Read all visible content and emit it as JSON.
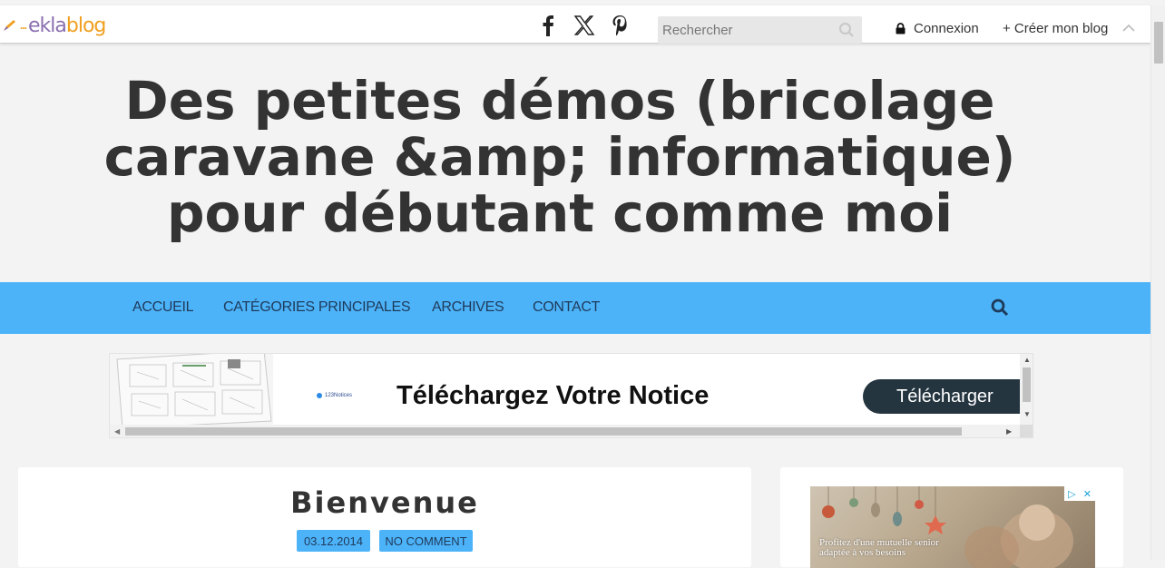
{
  "topbar": {
    "logo_ekla": "ekla",
    "logo_blog": "blog",
    "search_placeholder": "Rechercher",
    "login_label": "Connexion",
    "create_label": "+ Créer mon blog"
  },
  "site": {
    "title": "Des petites démos (bricolage caravane &amp; informatique) pour débutant comme moi"
  },
  "nav": {
    "items": [
      {
        "label": "ACCUEIL"
      },
      {
        "label": "CATÉGORIES PRINCIPALES"
      },
      {
        "label": "ARCHIVES"
      },
      {
        "label": "CONTACT"
      }
    ]
  },
  "ad_banner": {
    "brand": "123Notices",
    "headline": "Téléchargez Votre Notice",
    "button_label": "Télécharger"
  },
  "post": {
    "title": "Bienvenue",
    "date": "03.12.2014",
    "comments": "NO COMMENT"
  },
  "sidebar_ad": {
    "text_line1": "Profitez d'une mutuelle senior",
    "text_line2": "adaptée à vos besoins"
  },
  "colors": {
    "accent": "#4db3f9",
    "nav_text": "#1e3a5a",
    "title_text": "#333333",
    "ad_button": "#243540"
  }
}
